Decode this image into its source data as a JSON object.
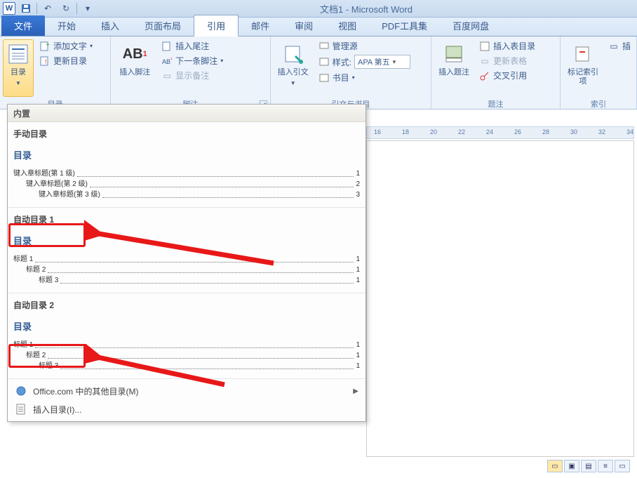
{
  "titlebar": {
    "app_icon": "W",
    "title": "文档1 - Microsoft Word"
  },
  "tabs": {
    "file": "文件",
    "items": [
      "开始",
      "插入",
      "页面布局",
      "引用",
      "邮件",
      "审阅",
      "视图",
      "PDF工具集",
      "百度网盘"
    ],
    "active_index": 3
  },
  "ribbon": {
    "toc": {
      "button": "目录",
      "add_text": "添加文字",
      "update": "更新目录",
      "group_label": "目录"
    },
    "footnotes": {
      "insert_footnote": "插入脚注",
      "ab_label": "AB",
      "insert_endnote": "插入尾注",
      "next_footnote": "下一条脚注",
      "show_notes": "显示备注",
      "group_label": "脚注"
    },
    "citations": {
      "insert_citation": "插入引文",
      "manage": "管理源",
      "style_label": "样式:",
      "style_value": "APA 第五",
      "bibliography": "书目",
      "group_label": "引文与书目"
    },
    "captions": {
      "insert_caption": "插入题注",
      "insert_tof": "插入表目录",
      "update_table": "更新表格",
      "cross_ref": "交叉引用",
      "group_label": "题注"
    },
    "index": {
      "mark_entry": "标记索引项",
      "group_label": "索引"
    }
  },
  "toc_panel": {
    "builtin_header": "内置",
    "manual": {
      "label": "手动目录",
      "title": "目录",
      "lines": [
        {
          "level": 1,
          "text": "键入章标题(第 1 级)",
          "page": "1"
        },
        {
          "level": 2,
          "text": "键入章标题(第 2 级)",
          "page": "2"
        },
        {
          "level": 3,
          "text": "键入章标题(第 3 级)",
          "page": "3"
        }
      ]
    },
    "auto1": {
      "label": "自动目录 1",
      "title": "目录",
      "lines": [
        {
          "level": 1,
          "text": "标题 1",
          "page": "1"
        },
        {
          "level": 2,
          "text": "标题 2",
          "page": "1"
        },
        {
          "level": 3,
          "text": "标题 3",
          "page": "1"
        }
      ]
    },
    "auto2": {
      "label": "自动目录 2",
      "title": "目录",
      "lines": [
        {
          "level": 1,
          "text": "标题 1",
          "page": "1"
        },
        {
          "level": 2,
          "text": "标题 2",
          "page": "1"
        },
        {
          "level": 3,
          "text": "标题 3",
          "page": "1"
        }
      ]
    },
    "more_office": "Office.com 中的其他目录(M)",
    "insert_toc": "插入目录(I)..."
  },
  "ruler": {
    "ticks": [
      "16",
      "18",
      "20",
      "22",
      "24",
      "26",
      "28",
      "30",
      "32",
      "34"
    ]
  }
}
